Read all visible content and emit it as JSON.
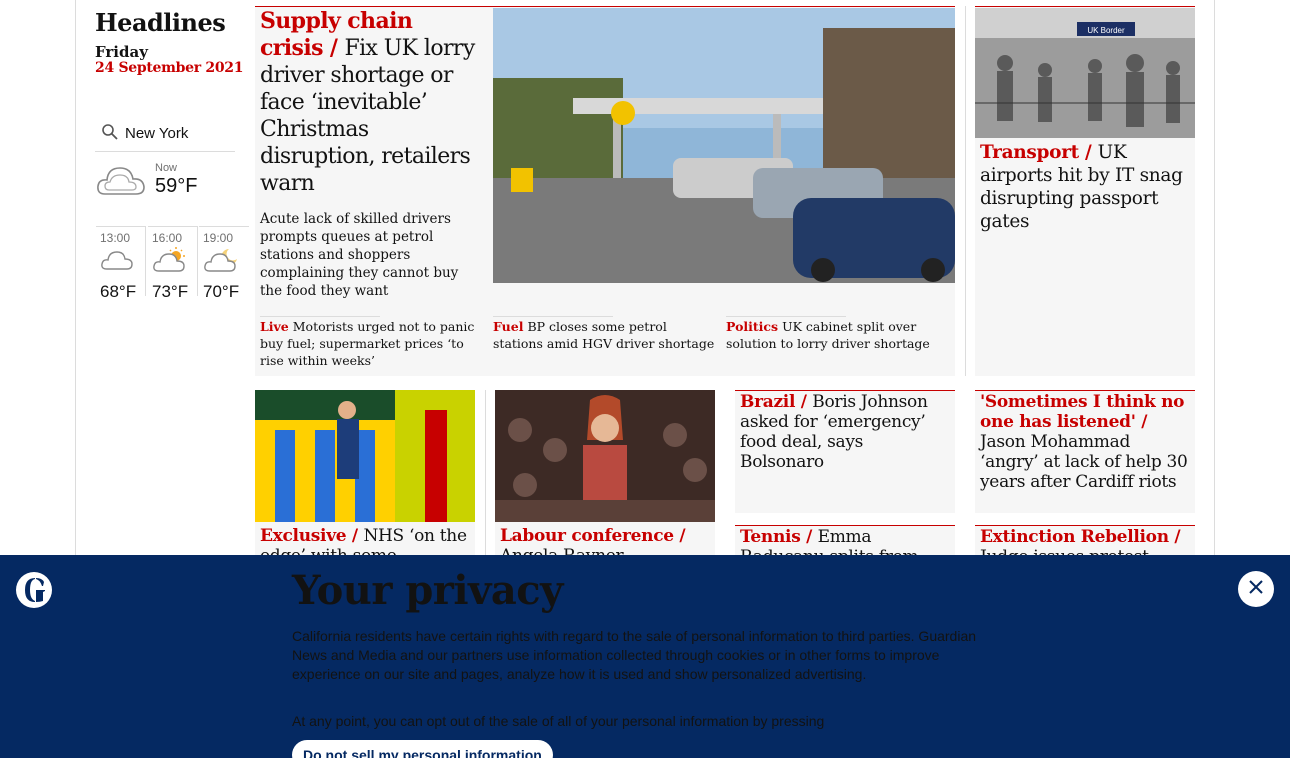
{
  "sidebar": {
    "headlines_title": "Headlines",
    "day": "Friday",
    "date": "24 September 2021",
    "location": "New York",
    "now_label": "Now",
    "now_temp": "59°F",
    "forecast": [
      {
        "time": "13:00",
        "temp": "68°F",
        "icon": "cloud-icon"
      },
      {
        "time": "16:00",
        "temp": "73°F",
        "icon": "sun-cloud-icon"
      },
      {
        "time": "19:00",
        "temp": "70°F",
        "icon": "moon-cloud-icon"
      }
    ]
  },
  "main_story": {
    "kicker": "Supply chain crisis",
    "slash": " / ",
    "headline": "Fix UK lorry driver shortage or face ‘inevitable’ Christmas disruption, retailers warn",
    "standfirst": "Acute lack of skilled drivers prompts queues at petrol stations and shoppers complaining they cannot buy the food they want",
    "sublinks": [
      {
        "kicker": "Live",
        "text": "Motorists urged not to panic buy fuel; supermarket prices ‘to rise within weeks’"
      },
      {
        "kicker": "Fuel",
        "text": "BP closes some petrol stations amid HGV driver shortage"
      },
      {
        "kicker": "Politics",
        "text": "UK cabinet split over solution to lorry driver shortage"
      }
    ]
  },
  "side_story": {
    "kicker": "Transport /",
    "headline": "UK airports hit by IT snag disrupting passport gates",
    "sign_text": "UK Border"
  },
  "row2": [
    {
      "kicker": "Exclusive /",
      "headline": "NHS ‘on the edge’ with some"
    },
    {
      "kicker": "Labour conference /",
      "headline": "Angela Rayner"
    },
    {
      "kicker": "Brazil /",
      "headline": "Boris Johnson asked for ‘emergency’ food deal, says Bolsonaro"
    },
    {
      "kicker": "'Sometimes I think no one has listened' /",
      "headline": "Jason Mohammad ‘angry’ at lack of help 30 years after Cardiff riots"
    }
  ],
  "row3": [
    {
      "kicker": "Tennis /",
      "headline": "Emma Raducanu splits from coach who"
    },
    {
      "kicker": "Extinction Rebellion /",
      "headline": "Judge issues protest"
    }
  ],
  "privacy": {
    "title": "Your privacy",
    "body": "California residents have certain rights with regard to the sale of personal information to third parties. Guardian News and Media and our partners use information collected through cookies or in other forms to improve experience on our site and pages, analyze how it is used and show personalized advertising.",
    "body2": "At any point, you can opt out of the sale of all of your personal information by pressing",
    "button": "Do not sell my personal information"
  },
  "colors": {
    "accent": "#c70000",
    "banner": "#052962",
    "card": "#f6f6f6"
  }
}
